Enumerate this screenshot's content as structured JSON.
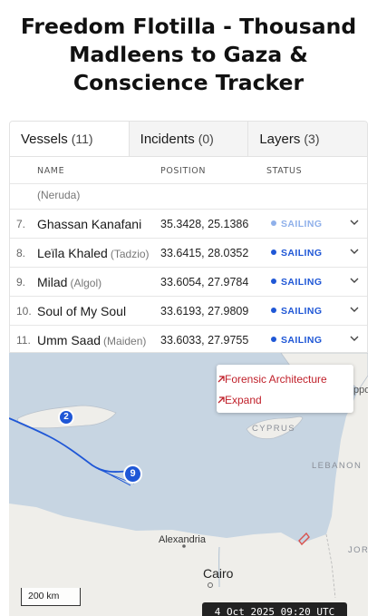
{
  "page_title": "Freedom Flotilla - Thousand Madleens to Gaza & Conscience Tracker",
  "tabs": [
    {
      "label": "Vessels",
      "count": "(11)"
    },
    {
      "label": "Incidents",
      "count": "(0)"
    },
    {
      "label": "Layers",
      "count": "(3)"
    }
  ],
  "columns": {
    "name": "NAME",
    "position": "POSITION",
    "status": "STATUS"
  },
  "partial_row": {
    "alias": "(Neruda)"
  },
  "vessels": [
    {
      "num": "7.",
      "name": "Ghassan Kanafani",
      "alias": "",
      "position": "35.3428, 25.1386",
      "status": "SAILING",
      "status_color": "#8fb0ea"
    },
    {
      "num": "8.",
      "name": "Leïla Khaled",
      "alias": "(Tadzio)",
      "position": "33.6415, 28.0352",
      "status": "SAILING",
      "status_color": "#1f57d6"
    },
    {
      "num": "9.",
      "name": "Milad",
      "alias": "(Algol)",
      "position": "33.6054, 27.9784",
      "status": "SAILING",
      "status_color": "#1f57d6"
    },
    {
      "num": "10.",
      "name": "Soul of My Soul",
      "alias": "",
      "position": "33.6193, 27.9809",
      "status": "SAILING",
      "status_color": "#1f57d6"
    },
    {
      "num": "11.",
      "name": "Umm Saad",
      "alias": "(Maiden)",
      "position": "33.6033, 27.9755",
      "status": "SAILING",
      "status_color": "#1f57d6"
    }
  ],
  "map_menu": {
    "forensic": "Forensic Architecture",
    "expand": "Expand"
  },
  "map_labels": {
    "cyprus": "CYPRUS",
    "lebanon": "LEBANON",
    "alexandria": "Alexandria",
    "cairo": "Cairo",
    "jordan_partial": "JOR",
    "right_edge_partial": "ppo"
  },
  "markers": {
    "crete": "2",
    "fleet": "9"
  },
  "scale": "200 km",
  "timestamp": "4 Oct 2025 09:20 UTC",
  "colors": {
    "accent_red": "#c0202a",
    "vessel_blue": "#1f57d6",
    "sea": "#c7d5e2",
    "land": "#efeeea"
  }
}
